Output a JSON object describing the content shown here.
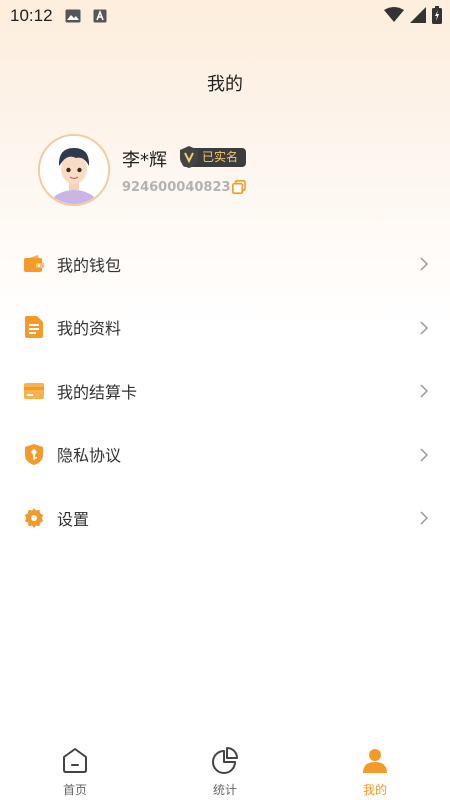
{
  "status_bar": {
    "time": "10:12"
  },
  "header": {
    "title": "我的"
  },
  "profile": {
    "name": "李*辉",
    "verified_label": "已实名",
    "uid": "924600040823"
  },
  "menu": [
    {
      "label": "我的钱包",
      "icon": "wallet-icon"
    },
    {
      "label": "我的资料",
      "icon": "document-icon"
    },
    {
      "label": "我的结算卡",
      "icon": "card-icon"
    },
    {
      "label": "隐私协议",
      "icon": "shield-key-icon"
    },
    {
      "label": "设置",
      "icon": "gear-icon"
    }
  ],
  "tabs": [
    {
      "label": "首页",
      "icon": "home-icon"
    },
    {
      "label": "统计",
      "icon": "pie-chart-icon"
    },
    {
      "label": "我的",
      "icon": "person-icon",
      "active": true
    }
  ],
  "colors": {
    "accent": "#f39a2b",
    "badge_bg": "#3c3c3c",
    "badge_text": "#f2c877"
  }
}
